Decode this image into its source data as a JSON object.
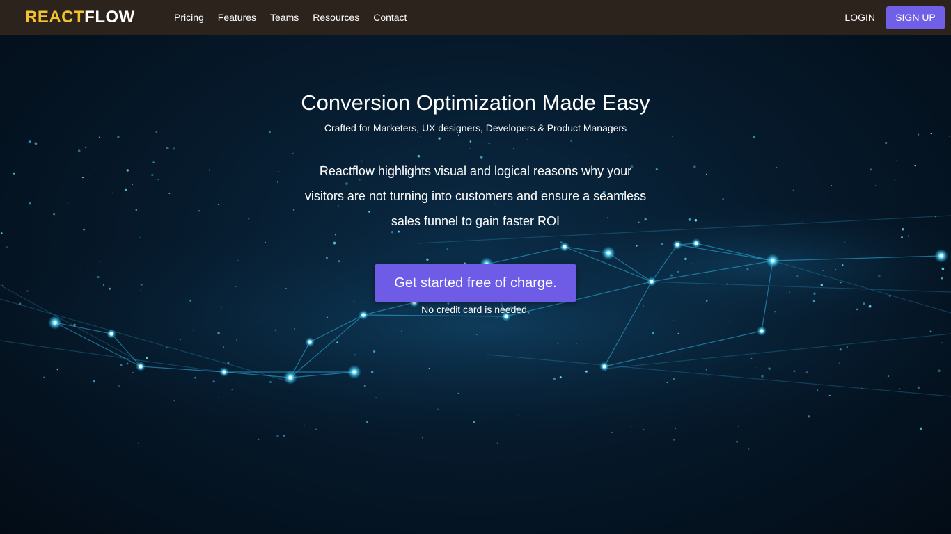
{
  "navbar": {
    "logo_part1": "REACT",
    "logo_part2": "FLOW",
    "links": [
      "Pricing",
      "Features",
      "Teams",
      "Resources",
      "Contact"
    ],
    "login": "LOGIN",
    "signup": "SIGN UP"
  },
  "hero": {
    "title": "Conversion Optimization Made Easy",
    "subtitle": "Crafted for Marketers, UX designers, Developers & Product Managers",
    "description": "Reactflow highlights visual and logical reasons why your visitors are not turning into customers and ensure a seamless sales funnel to gain faster ROI",
    "cta": "Get started free of charge.",
    "cta_note": "No credit card is needed."
  },
  "colors": {
    "navbar_bg": "#2c231d",
    "logo_accent": "#f2c32c",
    "button_accent": "#6e5ce6",
    "network_glow": "#3fd6ff"
  }
}
